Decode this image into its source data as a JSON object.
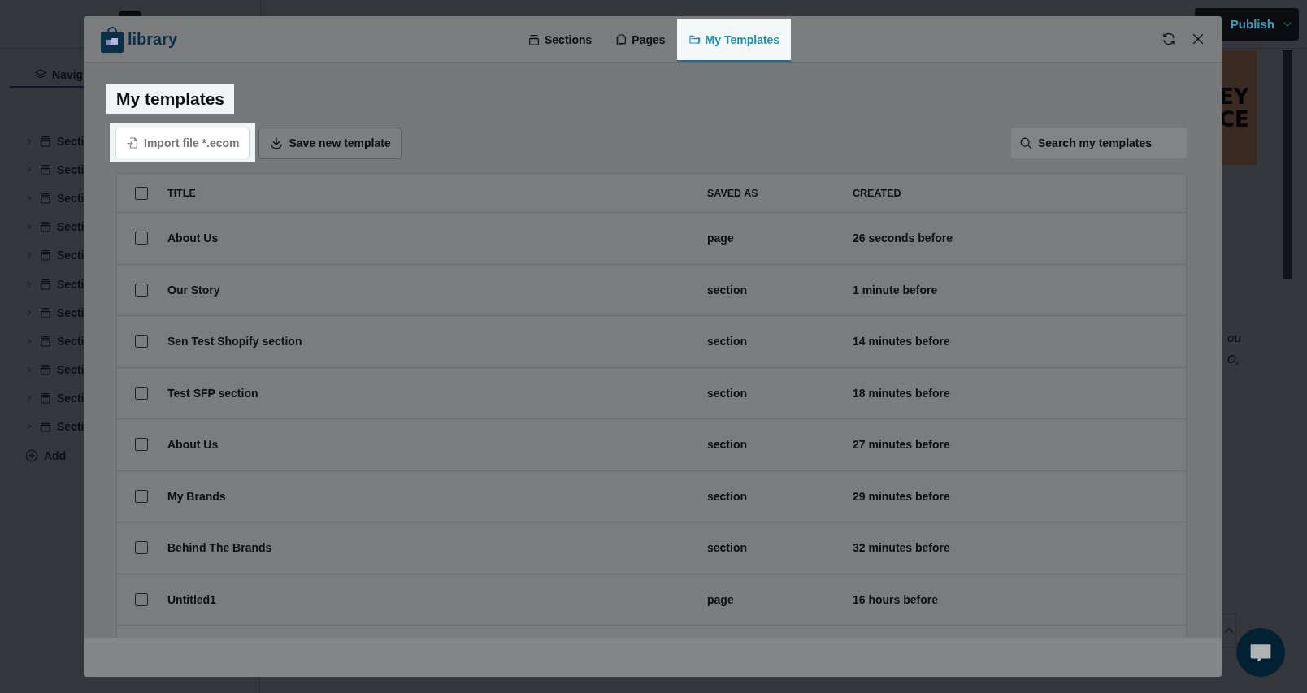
{
  "app": {
    "nav_tab": "Navig",
    "sidebar_items": [
      "Secti",
      "Secti",
      "Secti",
      "Secti",
      "Secti",
      "Secti",
      "Secti",
      "Secti",
      "Secti",
      "Secti",
      "Secti"
    ],
    "add_label": "Add",
    "publish": "Publish",
    "preview_heading": [
      "EY",
      "CE"
    ],
    "preview_text": [
      "ou",
      "O,"
    ]
  },
  "modal": {
    "logo": "library",
    "tabs": [
      {
        "label": "Sections",
        "selected": false
      },
      {
        "label": "Pages",
        "selected": false
      },
      {
        "label": "My Templates",
        "selected": true
      }
    ],
    "heading": "My templates",
    "import_button": "Import file *.ecom",
    "save_button": "Save new template",
    "search": {
      "placeholder": "Search my templates"
    },
    "table": {
      "columns": [
        "TITLE",
        "SAVED AS",
        "CREATED"
      ],
      "header_checked": false,
      "rows": [
        {
          "title": "About Us",
          "saved_as": "page",
          "created": "26 seconds before",
          "checked": false
        },
        {
          "title": "Our Story",
          "saved_as": "section",
          "created": "1 minute before",
          "checked": false
        },
        {
          "title": "Sen Test Shopify section",
          "saved_as": "section",
          "created": "14 minutes before",
          "checked": false
        },
        {
          "title": "Test SFP section",
          "saved_as": "section",
          "created": "18 minutes before",
          "checked": false
        },
        {
          "title": "About Us",
          "saved_as": "section",
          "created": "27 minutes before",
          "checked": false
        },
        {
          "title": "My Brands",
          "saved_as": "section",
          "created": "29 minutes before",
          "checked": false
        },
        {
          "title": "Behind The Brands",
          "saved_as": "section",
          "created": "32 minutes before",
          "checked": false
        },
        {
          "title": "Untitled1",
          "saved_as": "page",
          "created": "16 hours before",
          "checked": false
        }
      ]
    }
  }
}
